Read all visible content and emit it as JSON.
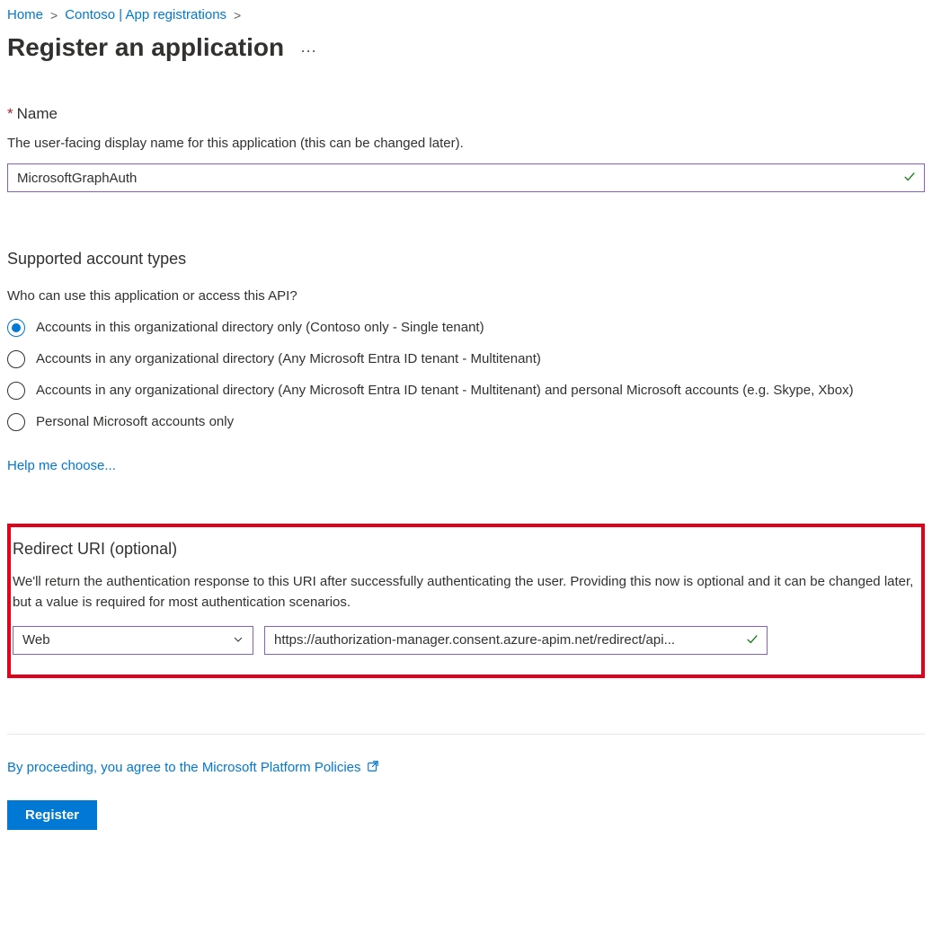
{
  "breadcrumb": {
    "home": "Home",
    "contoso": "Contoso | App registrations"
  },
  "page_title": "Register an application",
  "name_section": {
    "label": "Name",
    "description": "The user-facing display name for this application (this can be changed later).",
    "value": "MicrosoftGraphAuth"
  },
  "account_types": {
    "heading": "Supported account types",
    "subquestion": "Who can use this application or access this API?",
    "options": [
      "Accounts in this organizational directory only (Contoso only - Single tenant)",
      "Accounts in any organizational directory (Any Microsoft Entra ID tenant - Multitenant)",
      "Accounts in any organizational directory (Any Microsoft Entra ID tenant - Multitenant) and personal Microsoft accounts (e.g. Skype, Xbox)",
      "Personal Microsoft accounts only"
    ],
    "selected_index": 0,
    "help_link": "Help me choose..."
  },
  "redirect": {
    "heading": "Redirect URI (optional)",
    "description": "We'll return the authentication response to this URI after successfully authenticating the user. Providing this now is optional and it can be changed later, but a value is required for most authentication scenarios.",
    "platform": "Web",
    "uri_value": "https://authorization-manager.consent.azure-apim.net/redirect/api..."
  },
  "policy": {
    "prefix": "By proceeding, you agree to the ",
    "link_text": "Microsoft Platform Policies"
  },
  "register_button": "Register"
}
